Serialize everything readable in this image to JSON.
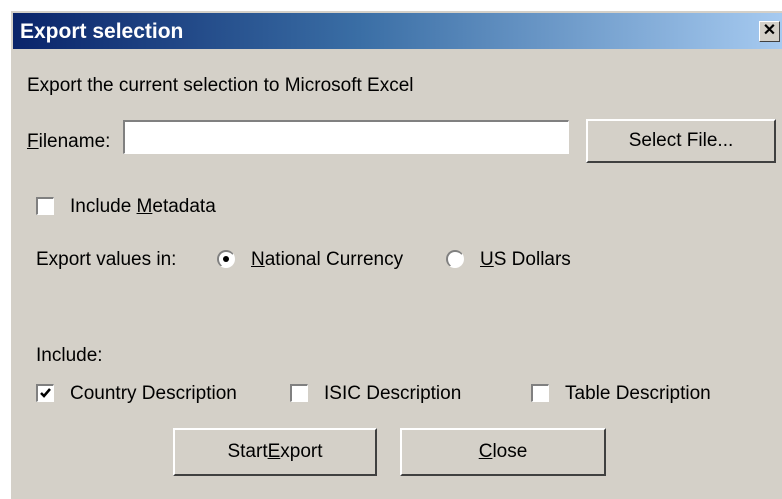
{
  "window": {
    "title": "Export selection",
    "close_glyph": "✕"
  },
  "description": "Export the current selection to Microsoft Excel",
  "filename": {
    "label_mnemonic": "F",
    "label_rest": "ilename:",
    "value": ""
  },
  "select_file_label": "Select File...",
  "include_metadata": {
    "prefix": "Include ",
    "mnemonic": "M",
    "rest": "etadata",
    "checked": false
  },
  "export_values": {
    "label": "Export values in:",
    "national": {
      "mnemonic": "N",
      "rest": "ational Currency",
      "selected": true
    },
    "usd": {
      "mnemonic": "U",
      "rest": "S Dollars",
      "selected": false
    }
  },
  "include": {
    "label": "Include:",
    "country": {
      "label": "Country Description",
      "checked": true
    },
    "isic": {
      "label": "ISIC Description",
      "checked": false
    },
    "table": {
      "label": "Table Description",
      "checked": false
    }
  },
  "buttons": {
    "start_prefix": "Start ",
    "start_mnemonic": "E",
    "start_rest": "xport",
    "close_mnemonic": "C",
    "close_rest": "lose"
  }
}
